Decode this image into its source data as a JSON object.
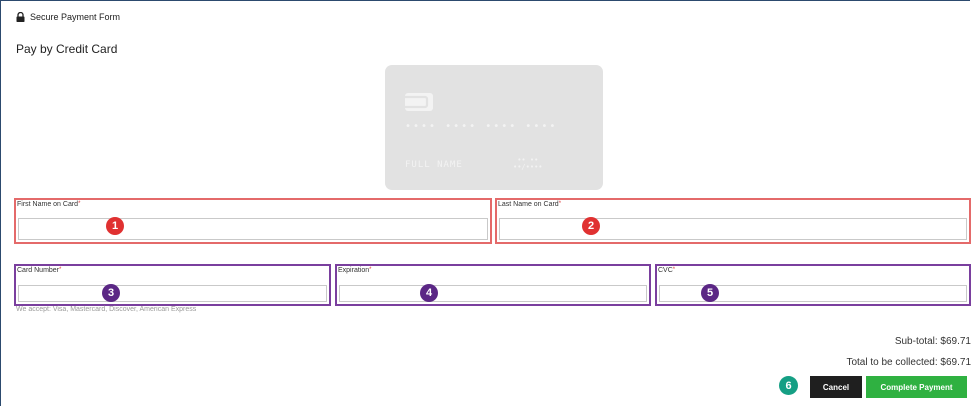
{
  "header": {
    "title": "Secure Payment Form",
    "icon": "lock-icon"
  },
  "form_title": "Pay by Credit Card",
  "card_preview": {
    "number": "•••• •••• •••• ••••",
    "name": "FULL NAME",
    "expiry_label": "•• ••",
    "expiry_value": "••/••••"
  },
  "fields": {
    "first_name": {
      "label": "First Name on Card",
      "required": "*",
      "value": "",
      "badge": "1"
    },
    "last_name": {
      "label": "Last Name on Card",
      "required": "*",
      "value": "",
      "badge": "2"
    },
    "card_number": {
      "label": "Card Number",
      "required": "*",
      "value": "",
      "badge": "3"
    },
    "expiration": {
      "label": "Expiration",
      "required": "*",
      "value": "",
      "badge": "4"
    },
    "cvc": {
      "label": "CVC",
      "required": "*",
      "value": "",
      "badge": "5"
    }
  },
  "accepted_cards": "We accept: Visa, Mastercard, Discover, American Express",
  "summary": {
    "subtotal": "Sub-total: $69.71",
    "total": "Total to be collected: $69.71"
  },
  "actions": {
    "badge": "6",
    "cancel": "Cancel",
    "complete": "Complete Payment"
  },
  "colors": {
    "required_field_border": "#e46a6a",
    "card_field_border": "#7a3f9e",
    "complete_button": "#2fb141",
    "cancel_button": "#1f1f1f"
  }
}
